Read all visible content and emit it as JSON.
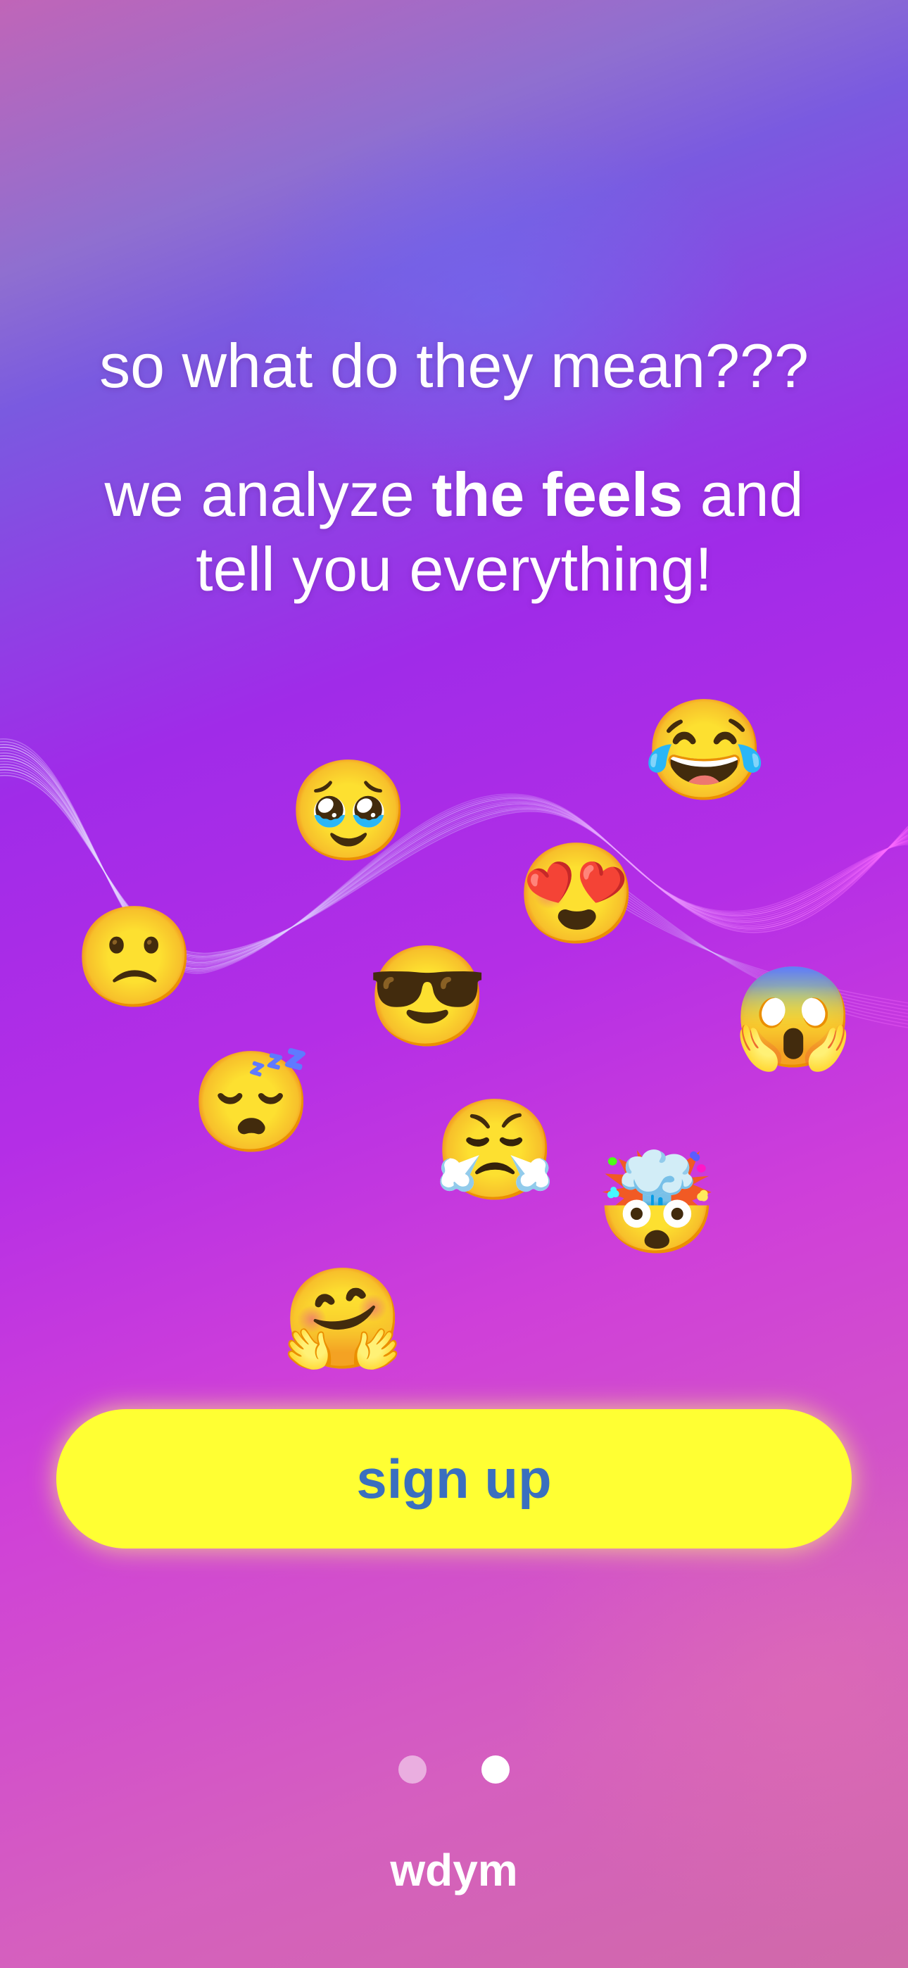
{
  "headline": "so what do they mean???",
  "subline": {
    "before": "we analyze ",
    "bold": "the feels",
    "after": " and tell you everything!"
  },
  "emojis": [
    {
      "name": "tears-of-joy",
      "char": "😂"
    },
    {
      "name": "pleading",
      "char": "🥹"
    },
    {
      "name": "heart-eyes",
      "char": "😍"
    },
    {
      "name": "frowning",
      "char": "🙁"
    },
    {
      "name": "sunglasses",
      "char": "😎"
    },
    {
      "name": "screaming",
      "char": "😱"
    },
    {
      "name": "sleeping",
      "char": "😴"
    },
    {
      "name": "steam-from-nose",
      "char": "😤"
    },
    {
      "name": "exploding-head",
      "char": "🤯"
    },
    {
      "name": "hugging",
      "char": "🤗"
    }
  ],
  "signup_button": {
    "label": "sign up"
  },
  "pagination": {
    "total": 2,
    "active_index": 1
  },
  "brand": "wdym",
  "colors": {
    "button": "#ffff33",
    "button_text": "#3a6fbf"
  }
}
